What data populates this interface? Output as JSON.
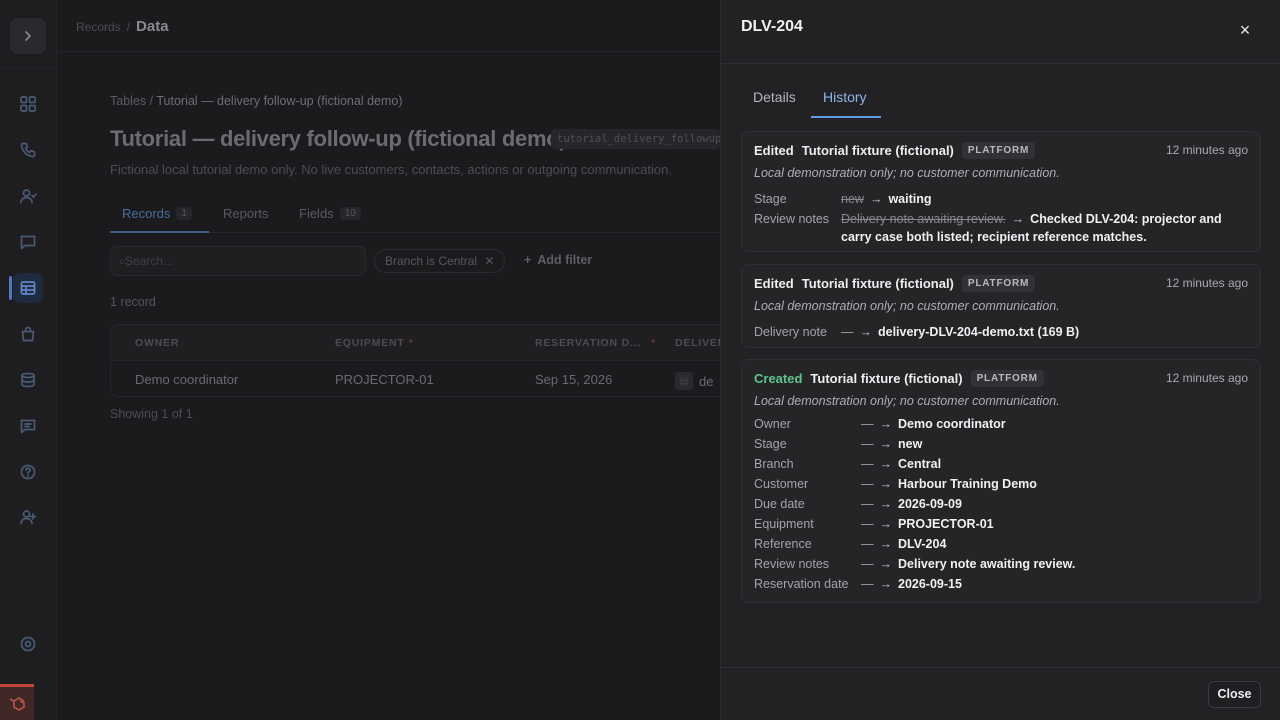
{
  "header": {
    "crumb_parent": "Records",
    "crumb_sep": "/",
    "crumb_current": "Data"
  },
  "page": {
    "breadcrumb_parent": "Tables",
    "breadcrumb_sep": "/",
    "breadcrumb_current": "Tutorial — delivery follow-up (fictional demo)",
    "title": "Tutorial — delivery follow-up (fictional demo)",
    "slug": "tutorial_delivery_followup",
    "description": "Fictional local tutorial demo only. No live customers, contacts, actions or outgoing communication.",
    "tabs": [
      {
        "label": "Records",
        "count": "1"
      },
      {
        "label": "Reports",
        "count": ""
      },
      {
        "label": "Fields",
        "count": "10"
      }
    ],
    "search_placeholder": "Search...",
    "filter_chip": "Branch is Central",
    "filter_remove": "✕",
    "add_filter": "Add filter",
    "record_count": "1 record",
    "table": {
      "headers": [
        "OWNER",
        "EQUIPMENT",
        "RESERVATION D...",
        "DELIVER"
      ],
      "required_mark": "*",
      "row": [
        "Demo coordinator",
        "PROJECTOR-01",
        "Sep 15, 2026",
        "de"
      ]
    },
    "showing": "Showing 1 of 1"
  },
  "drawer": {
    "title": "DLV-204",
    "close_glyph": "×",
    "tabs": [
      "Details",
      "History"
    ],
    "active_tab": "History",
    "close_button": "Close",
    "entries": [
      {
        "action": "Edited",
        "actor": "Tutorial fixture (fictional)",
        "badge": "PLATFORM",
        "time": "12 minutes ago",
        "note": "Local demonstration only; no customer communication.",
        "changes": [
          {
            "field": "Stage",
            "old": "new",
            "new": "waiting"
          },
          {
            "field": "Review notes",
            "old": "Delivery note awaiting review.",
            "new": "Checked DLV-204: projector and carry case both listed; recipient reference matches."
          }
        ]
      },
      {
        "action": "Edited",
        "actor": "Tutorial fixture (fictional)",
        "badge": "PLATFORM",
        "time": "12 minutes ago",
        "note": "Local demonstration only; no customer communication.",
        "changes": [
          {
            "field": "Delivery note",
            "old": "—",
            "new": "delivery-DLV-204-demo.txt (169 B)"
          }
        ]
      },
      {
        "action": "Created",
        "actor": "Tutorial fixture (fictional)",
        "badge": "PLATFORM",
        "time": "12 minutes ago",
        "note": "Local demonstration only; no customer communication.",
        "changes": [
          {
            "field": "Owner",
            "old": "—",
            "new": "Demo coordinator"
          },
          {
            "field": "Stage",
            "old": "—",
            "new": "new"
          },
          {
            "field": "Branch",
            "old": "—",
            "new": "Central"
          },
          {
            "field": "Customer",
            "old": "—",
            "new": "Harbour Training Demo"
          },
          {
            "field": "Due date",
            "old": "—",
            "new": "2026-09-09"
          },
          {
            "field": "Equipment",
            "old": "—",
            "new": "PROJECTOR-01"
          },
          {
            "field": "Reference",
            "old": "—",
            "new": "DLV-204"
          },
          {
            "field": "Review notes",
            "old": "—",
            "new": "Delivery note awaiting review."
          },
          {
            "field": "Reservation date",
            "old": "—",
            "new": "2026-09-15"
          }
        ]
      }
    ],
    "arrow": "→"
  },
  "sidebar_icons": [
    "grid-icon",
    "phone-icon",
    "contacts-icon",
    "chat-icon",
    "table-icon",
    "bag-icon",
    "database-icon",
    "message-icon",
    "help-icon",
    "add-user-icon",
    "settings-icon"
  ],
  "colors": {
    "accent": "#5f9ae0",
    "created": "#5ec58c",
    "brand": "#c0453a"
  }
}
